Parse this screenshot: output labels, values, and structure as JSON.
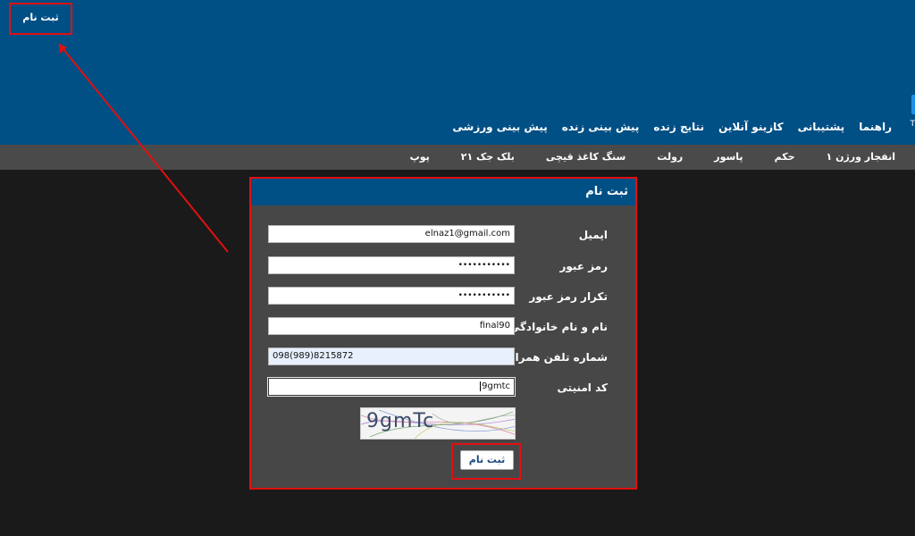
{
  "header": {
    "register_link": "ثبت نام",
    "edge_char": "T"
  },
  "main_nav": [
    {
      "label": "پیش بینی ورزشی"
    },
    {
      "label": "پیش بینی زنده"
    },
    {
      "label": "نتایج زنده"
    },
    {
      "label": "کازینو آنلاین"
    },
    {
      "label": "پشتیبانی"
    },
    {
      "label": "راهنما"
    }
  ],
  "sub_nav": [
    {
      "label": "انفجار ورژن ۱"
    },
    {
      "label": "حکم"
    },
    {
      "label": "پاسور"
    },
    {
      "label": "رولت"
    },
    {
      "label": "سنگ کاغذ قیچی"
    },
    {
      "label": "بلک جک ۲۱"
    },
    {
      "label": "پوپ"
    }
  ],
  "form": {
    "title": "ثبت نام",
    "email": {
      "label": "ایمیل",
      "value": "elnaz1@gmail.com"
    },
    "password": {
      "label": "رمز عبور",
      "value": "•••••••••••"
    },
    "password_confirm": {
      "label": "تکرار رمز عبور",
      "value": "•••••••••••"
    },
    "full_name": {
      "label": "نام و نام خانوادگی",
      "value": "final90"
    },
    "phone": {
      "label": "شماره تلفن همراه",
      "value": "098(989)8215872"
    },
    "security_code": {
      "label": "کد امنیتی",
      "value": "9gmtc"
    },
    "captcha_text": "9gmTc",
    "submit_label": "ثبت نام"
  },
  "colors": {
    "header_bg": "#004f85",
    "subnav_bg": "#4a4a4a",
    "panel_bg": "#474747",
    "page_bg": "#1a1a1a",
    "annotation": "#e01010"
  }
}
